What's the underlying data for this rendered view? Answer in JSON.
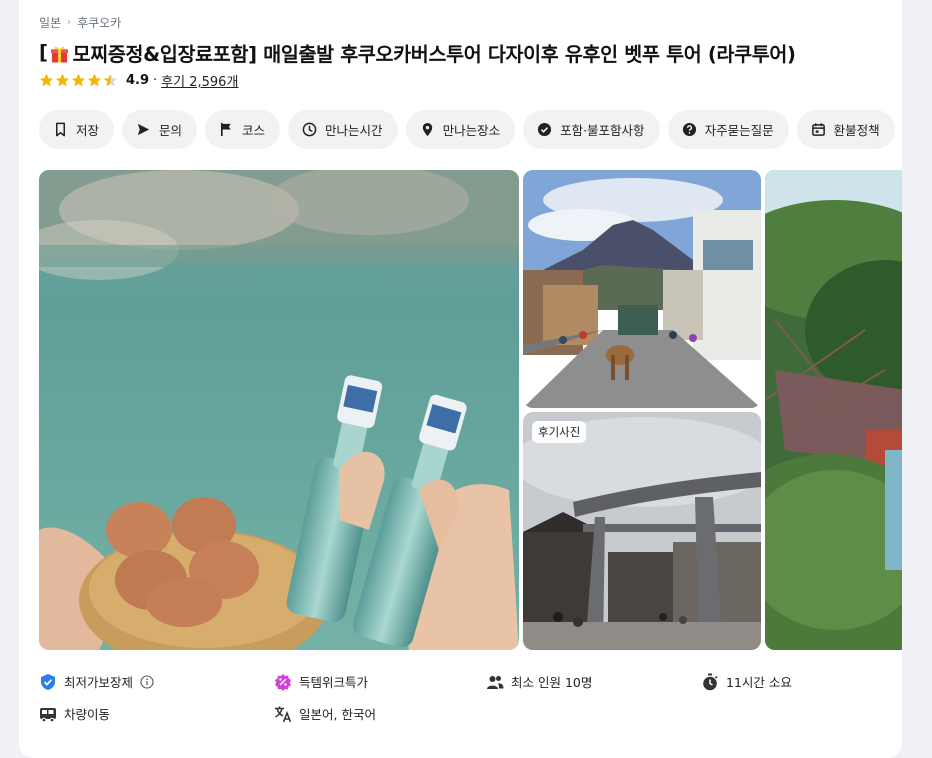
{
  "breadcrumb": {
    "country": "일본",
    "city": "후쿠오카"
  },
  "title": {
    "open_bracket": "[",
    "text": "모찌증정&입장료포함] 매일출발 후쿠오카버스투어 다자이후 유후인 벳푸 투어 (라쿠투어)",
    "gift_icon": "gift-icon"
  },
  "rating": {
    "score": "4.9",
    "separator": "·",
    "reviews": "후기 2,596개",
    "stars": 4.5,
    "max_stars": 5,
    "star_color": "#f5b50a"
  },
  "chips": [
    {
      "label": "저장",
      "icon": "bookmark-icon"
    },
    {
      "label": "문의",
      "icon": "send-icon"
    },
    {
      "label": "코스",
      "icon": "flag-icon"
    },
    {
      "label": "만나는시간",
      "icon": "clock-icon"
    },
    {
      "label": "만나는장소",
      "icon": "location-pin-icon"
    },
    {
      "label": "포함·불포함사항",
      "icon": "check-circle-icon"
    },
    {
      "label": "자주묻는질문",
      "icon": "question-circle-icon"
    },
    {
      "label": "환불정책",
      "icon": "calendar-icon"
    }
  ],
  "gallery": {
    "review_badge": "후기사진"
  },
  "features": [
    {
      "label": "최저가보장제",
      "icon": "shield-check-icon",
      "color": "#2b7de9"
    },
    {
      "label": "득템위크특가",
      "icon": "percent-badge-icon",
      "color": "#d63fd6"
    },
    {
      "label": "최소 인원 10명",
      "icon": "users-icon",
      "color": "#333333"
    },
    {
      "label": "11시간 소요",
      "icon": "stopwatch-icon",
      "color": "#333333"
    },
    {
      "label": "차량이동",
      "icon": "bus-icon",
      "color": "#333333"
    },
    {
      "label": "일본어, 한국어",
      "icon": "translate-icon",
      "color": "#333333"
    }
  ]
}
